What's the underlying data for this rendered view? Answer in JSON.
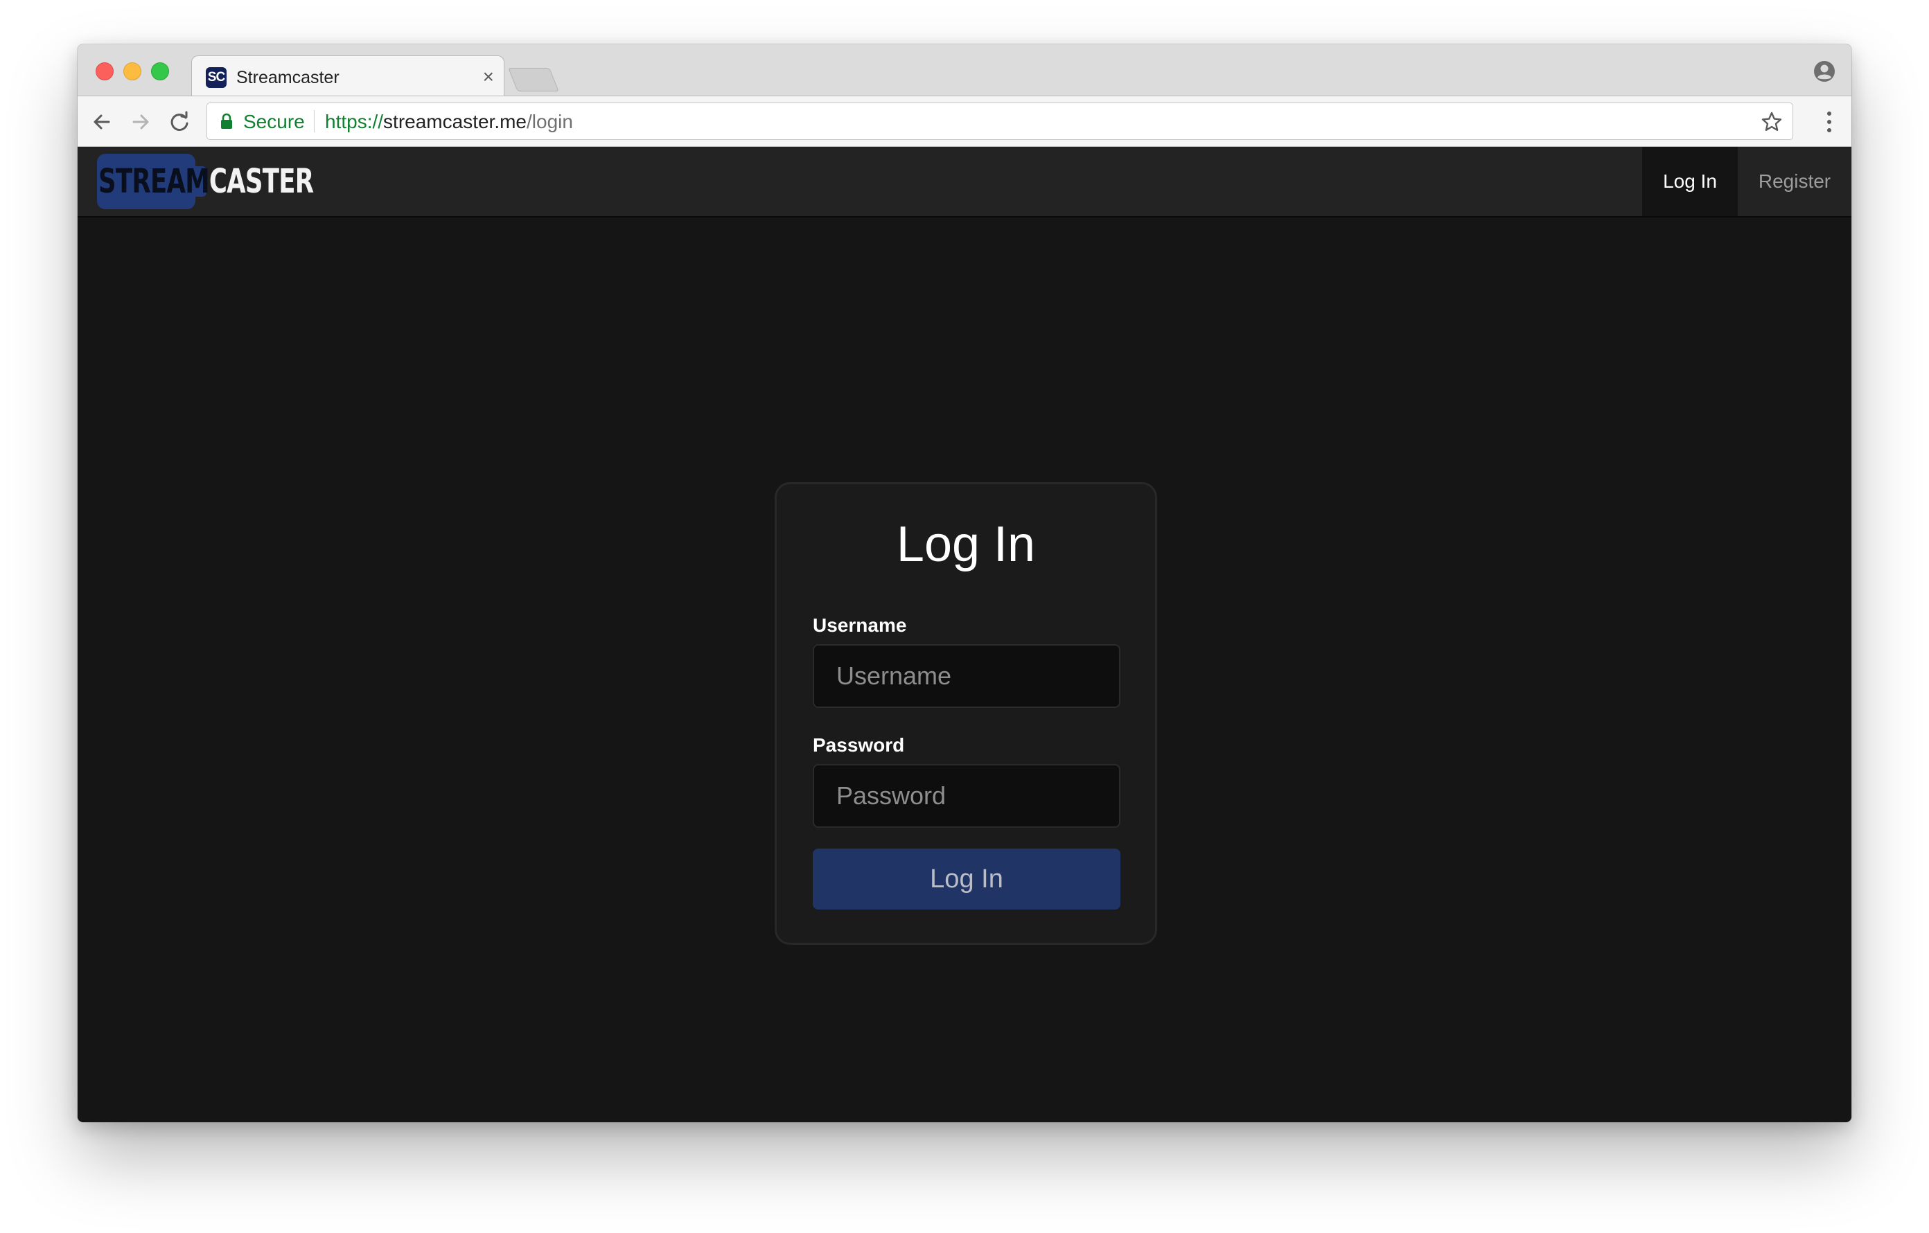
{
  "browser": {
    "tab": {
      "favicon_text": "SC",
      "title": "Streamcaster",
      "close_glyph": "×"
    },
    "address_bar": {
      "security_label": "Secure",
      "url_scheme": "https://",
      "url_host": "streamcaster.me",
      "url_path": "/login"
    },
    "icons": [
      "back-arrow-icon",
      "forward-arrow-icon",
      "reload-icon",
      "lock-icon",
      "star-icon",
      "menu-icon",
      "profile-icon"
    ]
  },
  "site": {
    "logo": {
      "part1": "STREAM",
      "part2": "CASTER"
    },
    "nav": {
      "login": "Log In",
      "register": "Register"
    },
    "login_form": {
      "title": "Log In",
      "username_label": "Username",
      "username_placeholder": "Username",
      "username_value": "",
      "password_label": "Password",
      "password_placeholder": "Password",
      "password_value": "",
      "submit_label": "Log In"
    }
  },
  "colors": {
    "page_background": "#151515",
    "navbar_background": "#232323",
    "brand_blue": "#223b7a",
    "button_blue": "#213466",
    "secure_green": "#118030"
  }
}
